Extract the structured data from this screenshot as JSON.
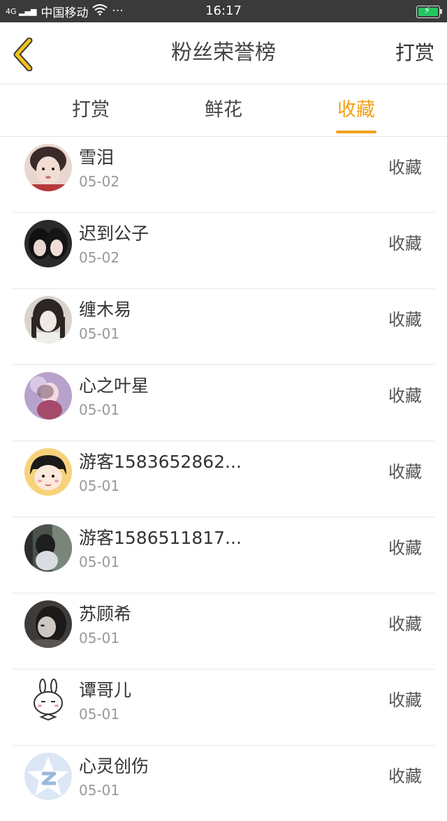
{
  "status_bar": {
    "network": "4G",
    "carrier": "中国移动",
    "more": "···",
    "time": "16:17"
  },
  "header": {
    "title": "粉丝荣誉榜",
    "action_label": "打赏"
  },
  "tabs": [
    {
      "label": "打赏",
      "active": false
    },
    {
      "label": "鲜花",
      "active": false
    },
    {
      "label": "收藏",
      "active": true
    }
  ],
  "colors": {
    "accent": "#f0a11a",
    "status_bar_bg": "#3a3a3a"
  },
  "fans": [
    {
      "name": "雪泪",
      "date": "05-02",
      "action": "收藏",
      "avatar_icon": "girl-photo-avatar"
    },
    {
      "name": "迟到公子",
      "date": "05-02",
      "action": "收藏",
      "avatar_icon": "couple-photo-avatar"
    },
    {
      "name": "缠木易",
      "date": "05-01",
      "action": "收藏",
      "avatar_icon": "girl-photo-avatar"
    },
    {
      "name": "心之叶星",
      "date": "05-01",
      "action": "收藏",
      "avatar_icon": "purple-photo-avatar"
    },
    {
      "name": "游客1583652862...",
      "date": "05-01",
      "action": "收藏",
      "avatar_icon": "cartoon-girl-avatar"
    },
    {
      "name": "游客1586511817...",
      "date": "05-01",
      "action": "收藏",
      "avatar_icon": "dark-photo-avatar"
    },
    {
      "name": "苏顾希",
      "date": "05-01",
      "action": "收藏",
      "avatar_icon": "dark-photo-avatar"
    },
    {
      "name": "谭哥儿",
      "date": "05-01",
      "action": "收藏",
      "avatar_icon": "rabbit-cartoon-avatar"
    },
    {
      "name": "心灵创伤",
      "date": "05-01",
      "action": "收藏",
      "avatar_icon": "default-star-avatar"
    }
  ]
}
